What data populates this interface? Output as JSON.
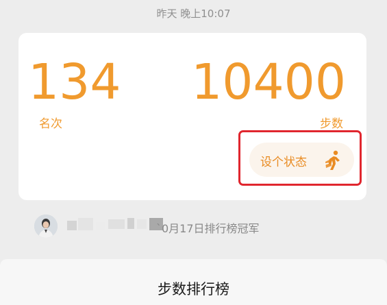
{
  "header": {
    "timestamp": "昨天 晚上10:07"
  },
  "stats_card": {
    "rank_value": "134",
    "rank_label": "名次",
    "steps_value": "10400",
    "steps_label": "步数",
    "status_button_label": "设个状态",
    "status_icon": "walking-person-icon",
    "highlight_color": "#e0262e",
    "accent_color": "#f09a2e"
  },
  "champion": {
    "text": "`0月17日排行榜冠军"
  },
  "bottom_sheet": {
    "title": "步数排行榜"
  }
}
